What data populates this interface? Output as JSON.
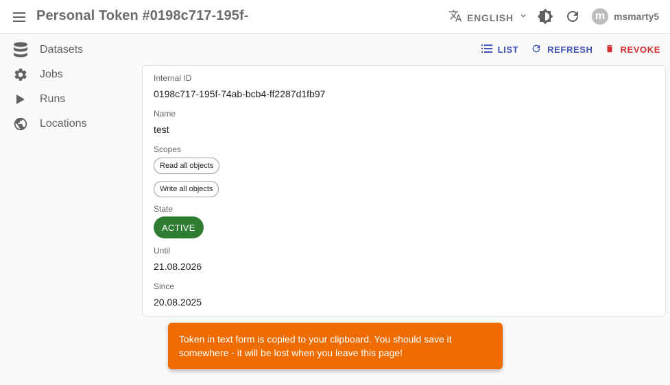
{
  "header": {
    "title": "Personal Token #0198c717-195f-",
    "language": "ENGLISH",
    "user_initial": "m",
    "user_name": "msmarty5"
  },
  "sidebar": {
    "items": [
      {
        "label": "Datasets",
        "icon": "database-icon"
      },
      {
        "label": "Jobs",
        "icon": "gear-icon"
      },
      {
        "label": "Runs",
        "icon": "play-icon"
      },
      {
        "label": "Locations",
        "icon": "globe-icon"
      }
    ]
  },
  "toolbar": {
    "list_label": "LIST",
    "refresh_label": "REFRESH",
    "revoke_label": "REVOKE"
  },
  "record": {
    "internal_id_label": "Internal ID",
    "internal_id": "0198c717-195f-74ab-bcb4-ff2287d1fb97",
    "name_label": "Name",
    "name": "test",
    "scopes_label": "Scopes",
    "scopes": [
      "Read all objects",
      "Write all objects"
    ],
    "state_label": "State",
    "state": "ACTIVE",
    "until_label": "Until",
    "until": "21.08.2026",
    "since_label": "Since",
    "since": "20.08.2025"
  },
  "notification": {
    "message": "Token in text form is copied to your clipboard. You should save it somewhere - it will be lost when you leave this page!"
  },
  "colors": {
    "primary": "#3f51b5",
    "danger": "#d32f2f",
    "active_state": "#2e7d32",
    "snackbar": "#ef6c00"
  }
}
